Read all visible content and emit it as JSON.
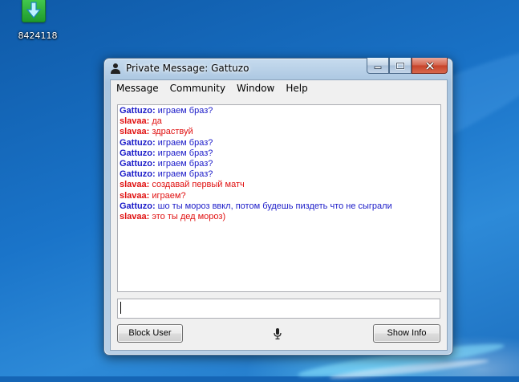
{
  "desktop": {
    "icon_name": "download-arrow-icon",
    "icon_label": "8424118",
    "accent_color": "#2ea63a"
  },
  "window": {
    "title": "Private Message: Gattuzo",
    "title_icon": "user-icon",
    "controls": {
      "minimize": "minimize-icon",
      "maximize": "maximize-icon",
      "close": "close-icon"
    }
  },
  "menu": [
    "Message",
    "Community",
    "Window",
    "Help"
  ],
  "chat": {
    "colors": {
      "Gattuzo": "#1a1ac8",
      "slavaa": "#e01010"
    },
    "messages": [
      {
        "sender": "Gattuzo:",
        "text": "играем браз?",
        "who": "g"
      },
      {
        "sender": "slavaa:",
        "text": "да",
        "who": "s"
      },
      {
        "sender": "slavaa:",
        "text": "здраствуй",
        "who": "s"
      },
      {
        "sender": "Gattuzo:",
        "text": "играем браз?",
        "who": "g"
      },
      {
        "sender": "Gattuzo:",
        "text": "играем браз?",
        "who": "g"
      },
      {
        "sender": "Gattuzo:",
        "text": "играем браз?",
        "who": "g"
      },
      {
        "sender": "Gattuzo:",
        "text": "играем браз?",
        "who": "g"
      },
      {
        "sender": "slavaa:",
        "text": "создавай первый матч",
        "who": "s"
      },
      {
        "sender": "slavaa:",
        "text": "играем?",
        "who": "s"
      },
      {
        "sender": "Gattuzo:",
        "text": "шо ты мороз ввкл, потом будешь пиздеть что не сыграли",
        "who": "g"
      },
      {
        "sender": "slavaa:",
        "text": "это ты дед мороз)",
        "who": "s"
      }
    ]
  },
  "input": {
    "value": ""
  },
  "buttons": {
    "block_user": "Block User",
    "show_info": "Show Info"
  },
  "voice": {
    "icon": "microphone-icon"
  }
}
